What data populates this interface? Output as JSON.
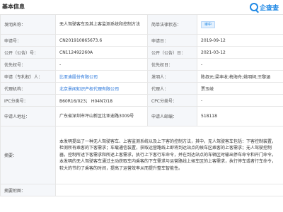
{
  "header": {
    "section_title": "基本信息",
    "logo_text": "企查查",
    "logo_icon": "magnifier-logo-icon"
  },
  "fields": {
    "title_label": "发明名称：",
    "title_value": "无人驾驶客车及其上客监测系统和控制方法",
    "legal_status_label": "简单法律状态：",
    "legal_status_value": "审中",
    "app_no_label": "申请号：",
    "app_no_value": "CN201910865673.6",
    "app_date_label": "申请日：",
    "app_date_value": "2019-09-12",
    "pub_no_label": "公开（公告）号：",
    "pub_no_value": "CN112492260A",
    "pub_date_label": "公开（公告）日：",
    "pub_date_value": "2021-03-12",
    "priority_no_label": "优先权号：",
    "priority_no_value": "-",
    "priority_date_label": "优先权日：",
    "priority_date_value": "-",
    "applicant_label": "申请（专利权）人：",
    "applicant_value": "比亚迪股份有限公司",
    "inventor_label": "发明人：",
    "inventor_value": "陈叔元;梁丰收;梅海舟;姚明轲;王黎涵",
    "agency_label": "代理机构：",
    "agency_value": "北京景闻知识产权代理有限公司",
    "agent_label": "代理人：",
    "agent_value": "贾玉岐",
    "ipc_label": "IPC分类号：",
    "ipc_value": "B60R16/023； H04N7/18",
    "cpc_label": "CPC分类号：",
    "cpc_value": "-",
    "address_label": "申请人地址：",
    "address_value": "广东省深圳市坪山新区比亚迪路3009号",
    "postcode_label": "申请人邮编：",
    "postcode_value": "518118",
    "abstract_label": "摘要：",
    "abstract_value": "本发明提出了一种无人驾驶客车、上客监测系统以及上下客的控制方法，其中，无人驾驶客车包括：下客控制装置，检测所有乘客的下客需求；车载通信装置，获取运营路线上即将到达站点的候车区乘客的上客需求；无人驾驶控制器，控制所述下客需求和所述上客需求，执行上下客行车命令，并在到达站点的车辆区时输出停车命令和开门命令。本发明的无人驾驶客车通过主动获取车内乘客的下车需求与运营路线上候车区的上客需求，执行停车或者行车命令，较大的节约了乘客的时间，提高了运营效率从而提升整车智能性。",
    "drawing_label": "摘要附图："
  }
}
